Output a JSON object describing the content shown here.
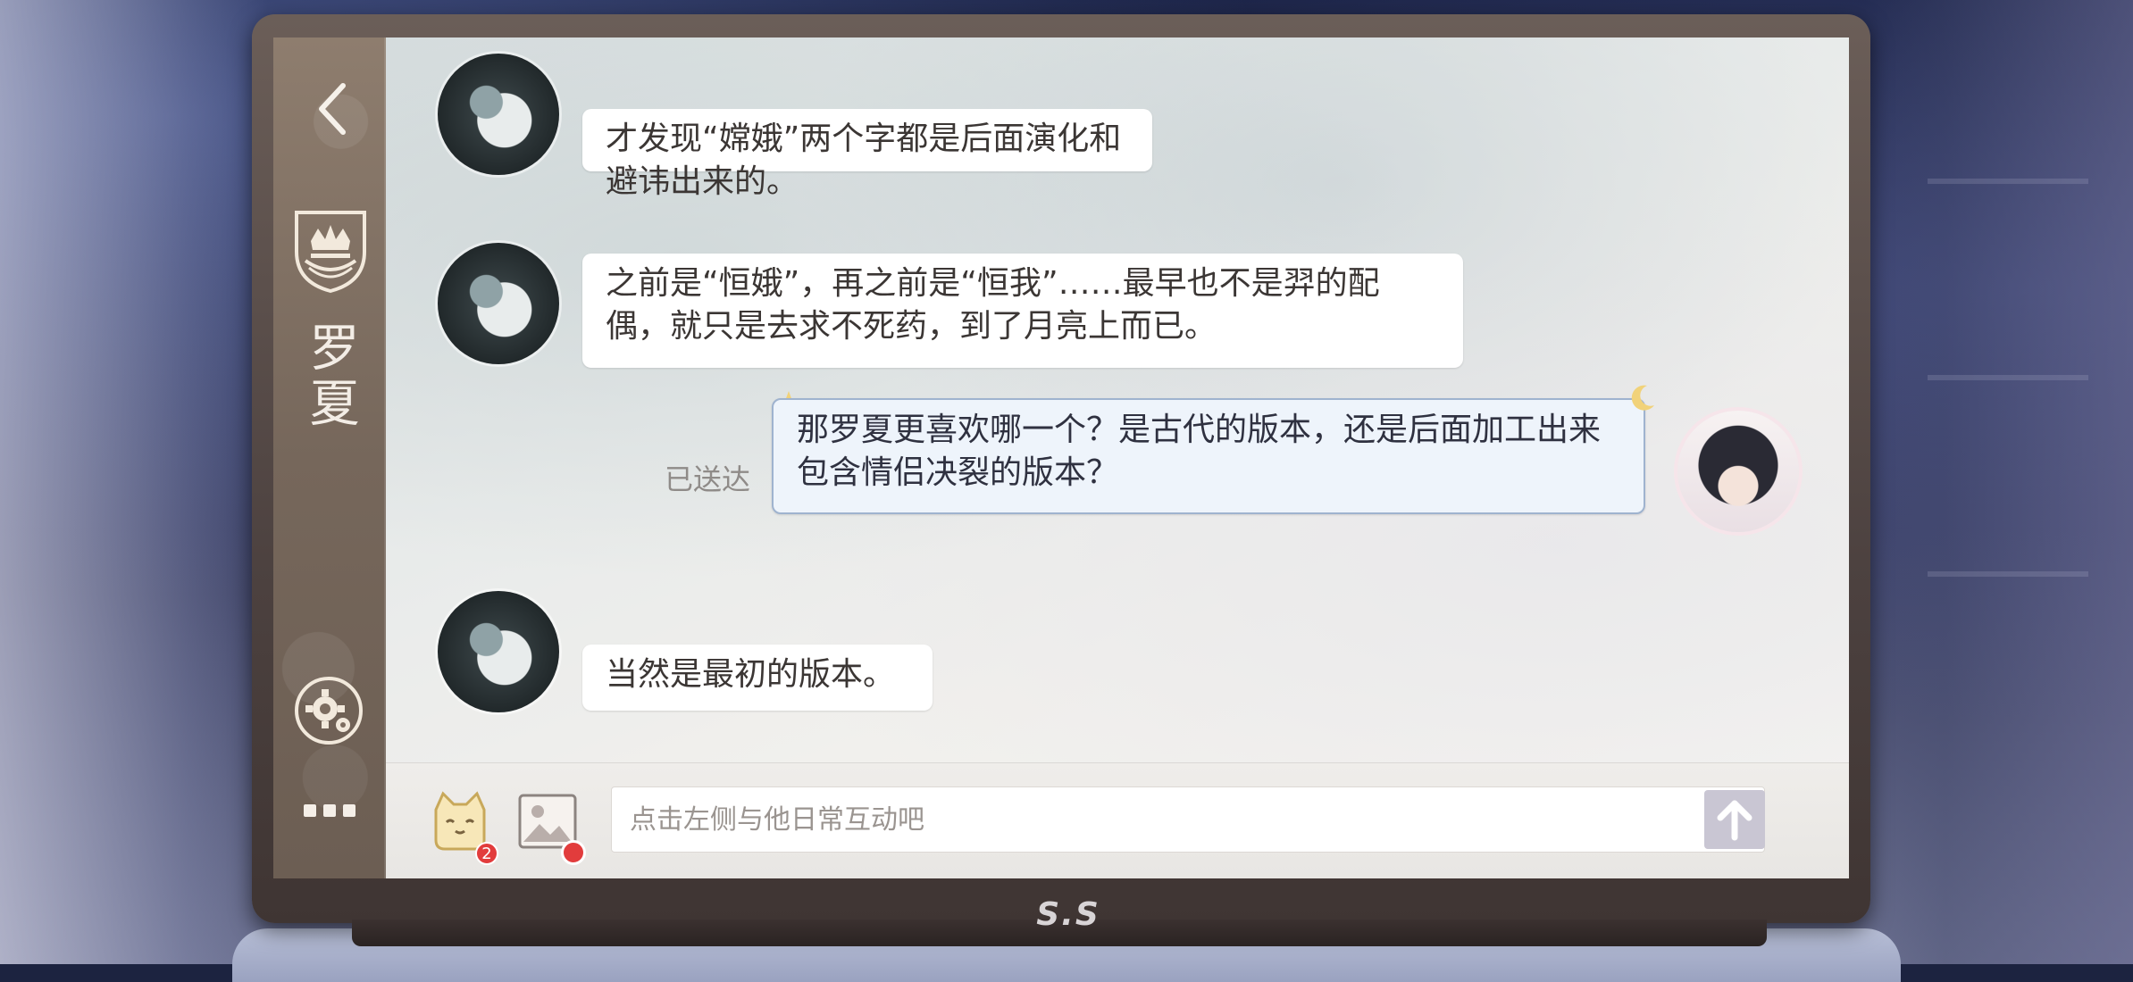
{
  "contact": {
    "name": "罗夏"
  },
  "messages": [
    {
      "sender": "contact",
      "text": "才发现“嫦娥”两个字都是后面演化和避讳出来的。"
    },
    {
      "sender": "contact",
      "text": "之前是“恒娥”，再之前是“恒我”……最早也不是羿的配偶，就只是去求不死药，到了月亮上而已。"
    },
    {
      "sender": "self",
      "text": "那罗夏更喜欢哪一个？是古代的版本，还是后面加工出来包含情侣决裂的版本？",
      "status": "已送达"
    },
    {
      "sender": "contact",
      "text": "当然是最初的版本。"
    }
  ],
  "input": {
    "placeholder": "点击左侧与他日常互动吧",
    "value": ""
  },
  "toolbar": {
    "sticker_badge": "2"
  },
  "device": {
    "brand": "S.S"
  },
  "icons": {
    "back": "chevron-left-icon",
    "crest": "crown-crest-icon",
    "settings": "gear-icon",
    "more": "more-dots-icon",
    "sticker": "cat-sticker-icon",
    "image": "image-icon",
    "send": "arrow-up-icon"
  },
  "colors": {
    "sidebar": "#7d6d60",
    "badge": "#e23c3c",
    "self_bubble": "#eef4fb",
    "self_bubble_border": "#9fb3cf",
    "send_button": "#c9c6d3"
  }
}
